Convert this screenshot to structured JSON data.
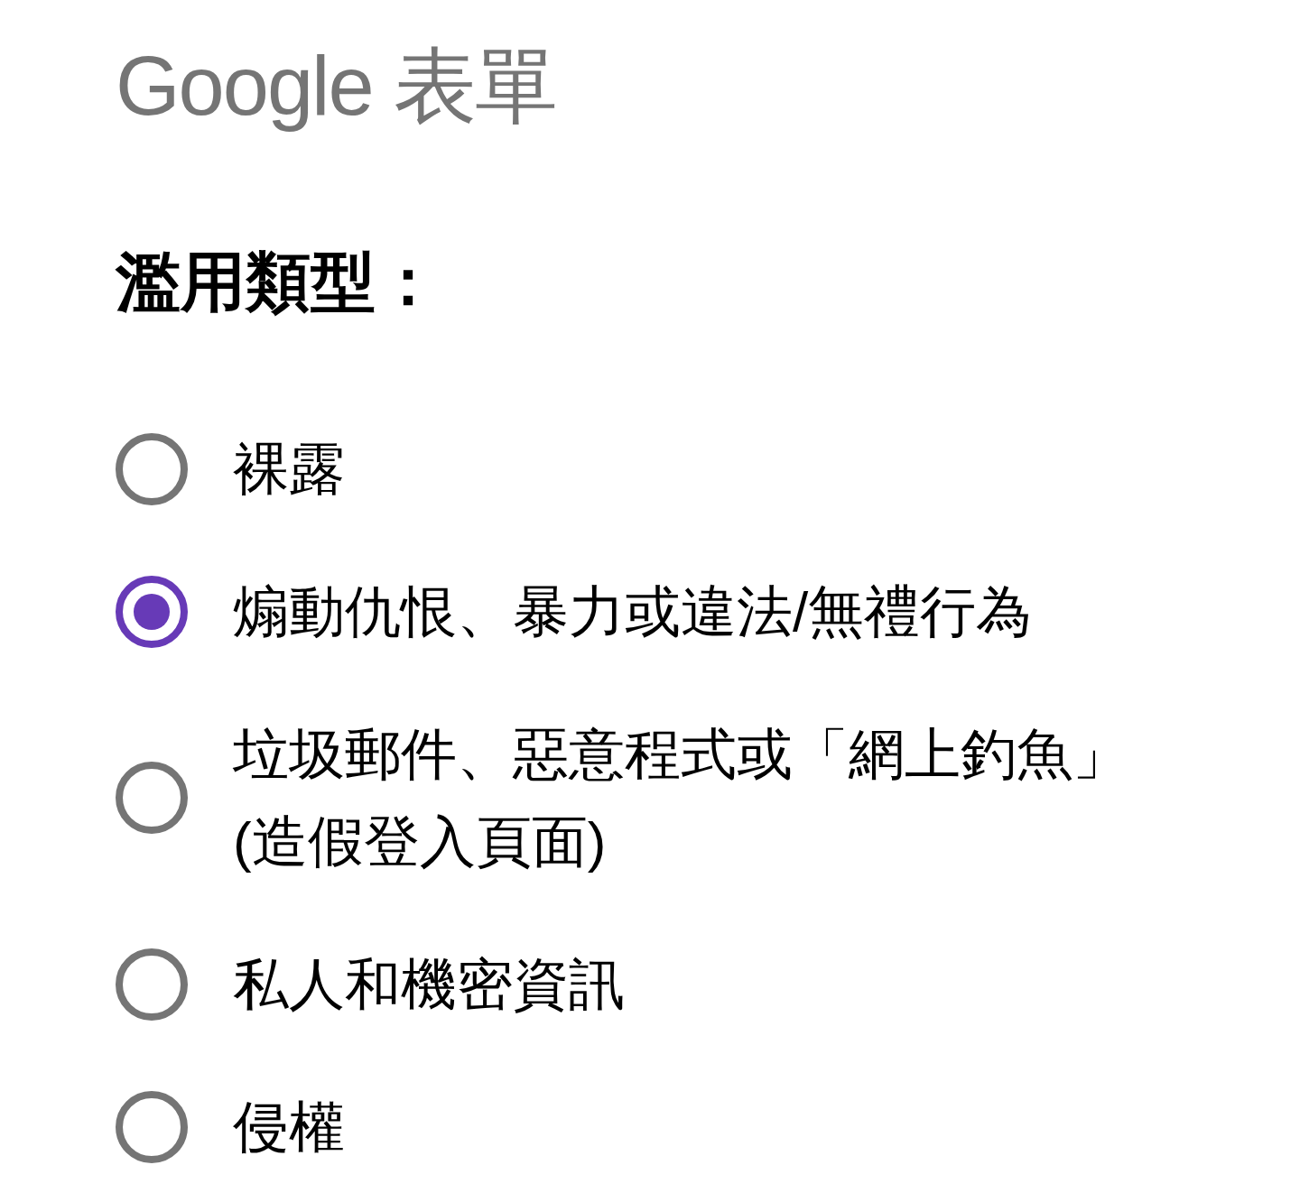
{
  "logo": {
    "text": "Google 表單"
  },
  "question": {
    "title": "濫用類型："
  },
  "options": [
    {
      "label": "裸露",
      "selected": false
    },
    {
      "label": "煽動仇恨、暴力或違法/無禮行為",
      "selected": true
    },
    {
      "label": "垃圾郵件、惡意程式或「網上釣魚」(造假登入頁面)",
      "selected": false
    },
    {
      "label": "私人和機密資訊",
      "selected": false
    },
    {
      "label": "侵權",
      "selected": false
    }
  ]
}
